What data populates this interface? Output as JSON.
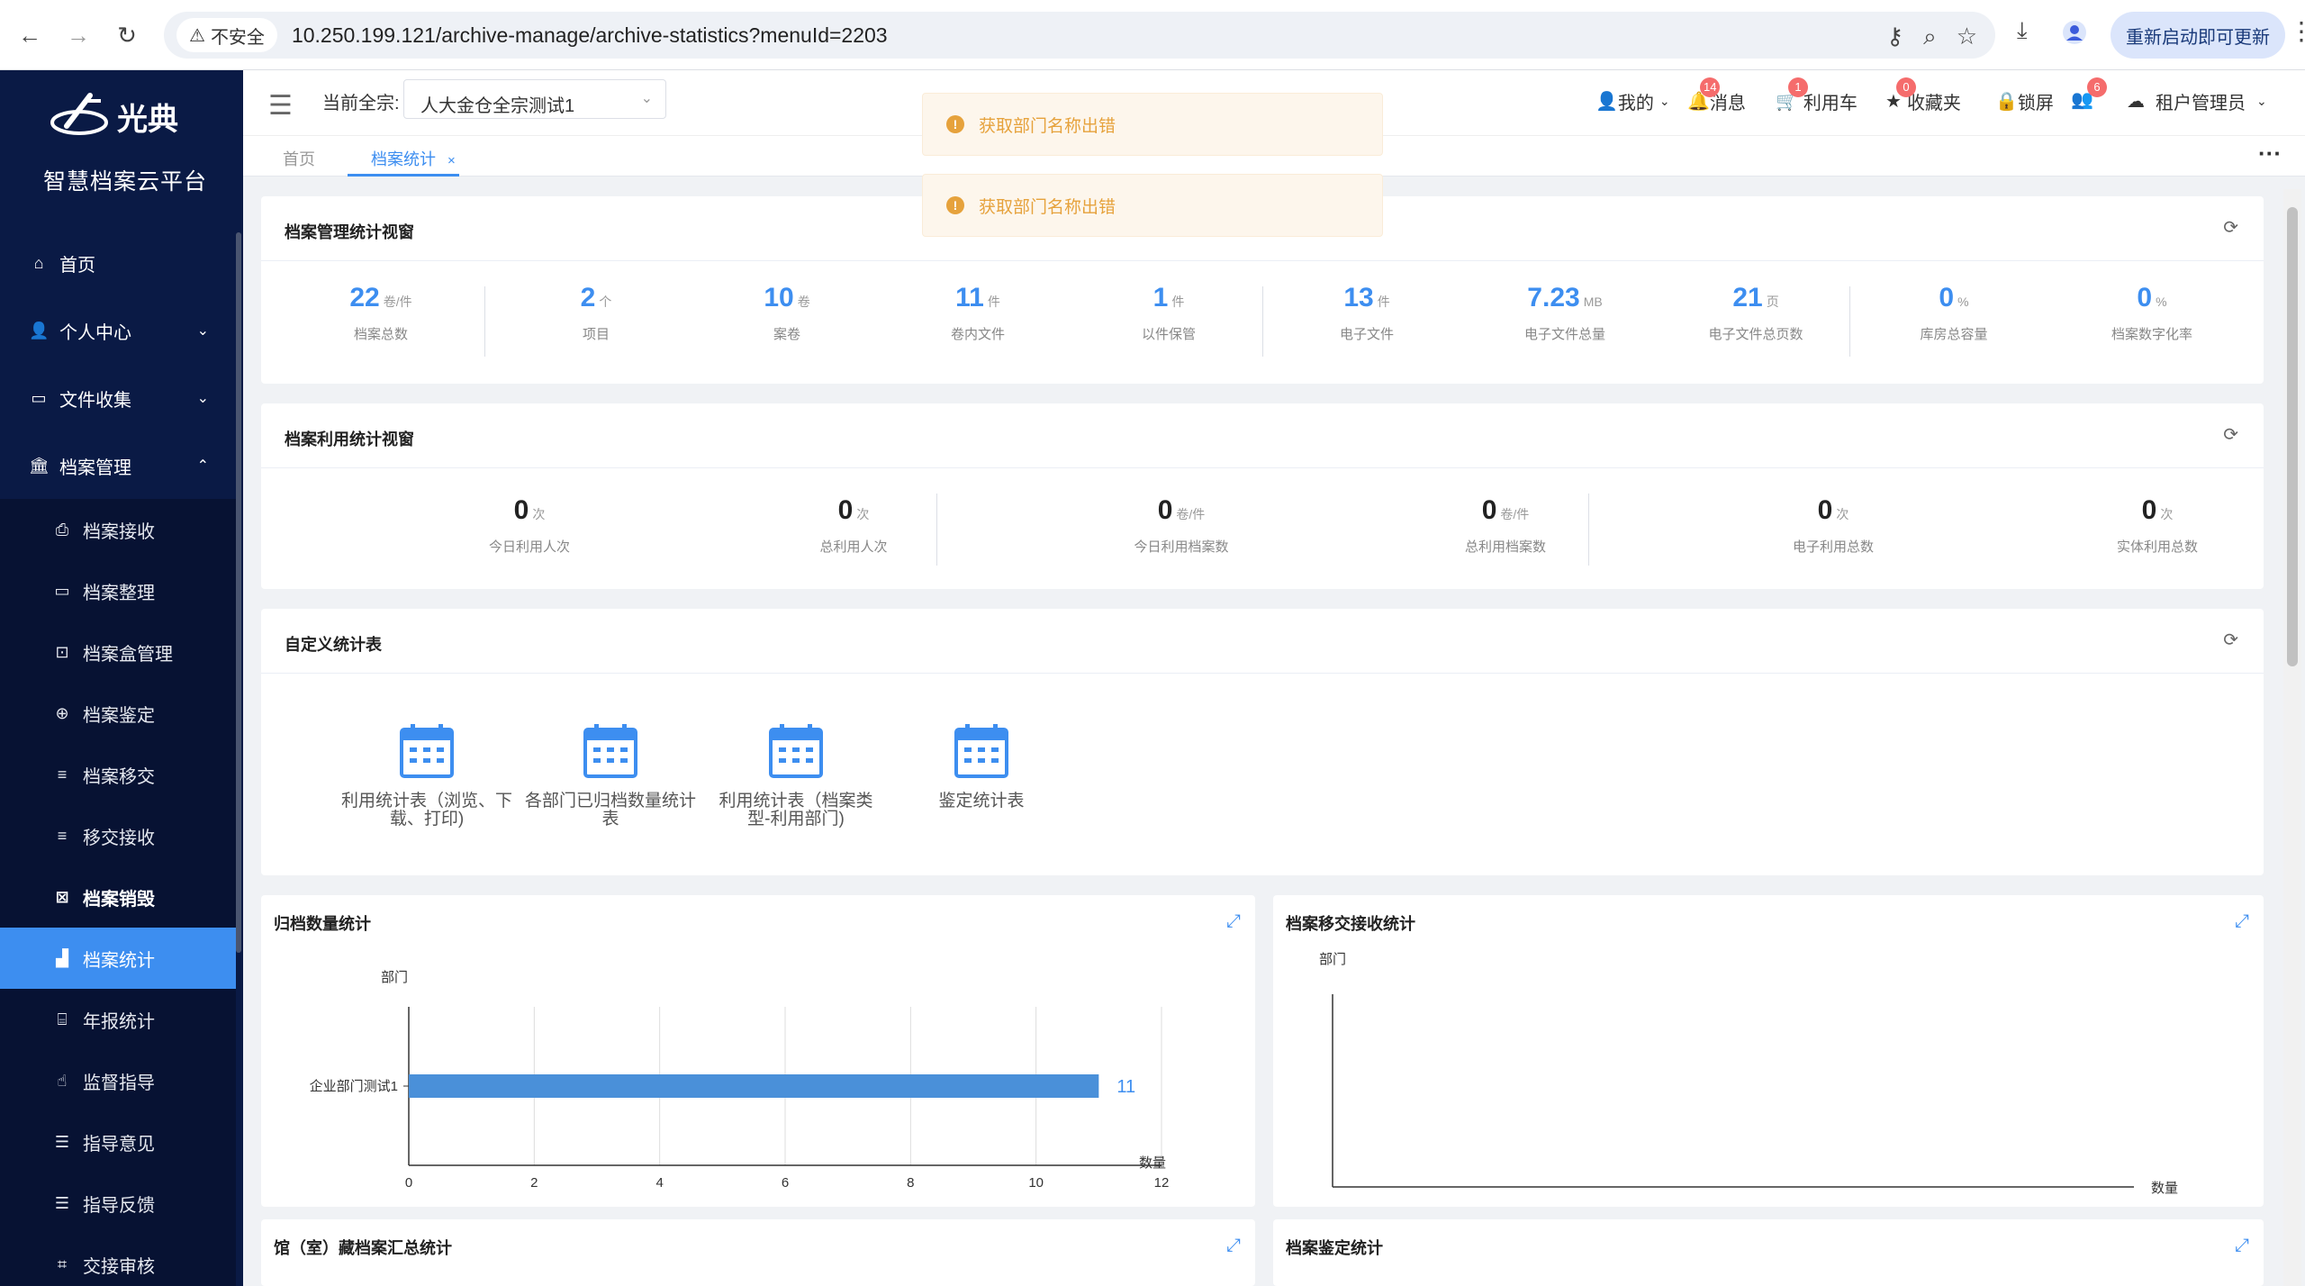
{
  "browser": {
    "insecure_label": "不安全",
    "url": "10.250.199.121/archive-manage/archive-statistics?menuId=2203",
    "restart_label": "重新启动即可更新"
  },
  "sidebar": {
    "logo_text": "光典",
    "platform_name": "智慧档案云平台",
    "items": [
      {
        "label": "首页",
        "icon": "home-icon"
      },
      {
        "label": "个人中心",
        "icon": "user-icon"
      },
      {
        "label": "文件收集",
        "icon": "briefcase-icon"
      },
      {
        "label": "档案管理",
        "icon": "bank-icon"
      }
    ],
    "subitems": [
      {
        "label": "档案接收"
      },
      {
        "label": "档案整理"
      },
      {
        "label": "档案盒管理"
      },
      {
        "label": "档案鉴定"
      },
      {
        "label": "档案移交"
      },
      {
        "label": "移交接收"
      },
      {
        "label": "档案销毁"
      },
      {
        "label": "档案统计"
      },
      {
        "label": "年报统计"
      },
      {
        "label": "监督指导"
      },
      {
        "label": "指导意见"
      },
      {
        "label": "指导反馈"
      },
      {
        "label": "交接审核"
      }
    ]
  },
  "topbar": {
    "quanzong_label": "当前全宗:",
    "quanzong_value": "人大金仓全宗测试1",
    "mine": "我的",
    "messages": "消息",
    "messages_badge": "14",
    "cart": "利用车",
    "cart_badge": "1",
    "favorites": "收藏夹",
    "favorites_badge": "0",
    "lock": "锁屏",
    "users_badge": "6",
    "tenant": "租户管理员"
  },
  "tabs": [
    {
      "label": "首页"
    },
    {
      "label": "档案统计",
      "close": "×"
    }
  ],
  "toasts": [
    "获取部门名称出错",
    "获取部门名称出错"
  ],
  "mgmt": {
    "title": "档案管理统计视窗",
    "stats": [
      {
        "num": "22",
        "unit": "卷/件",
        "label": "档案总数"
      },
      {
        "num": "2",
        "unit": "个",
        "label": "项目"
      },
      {
        "num": "10",
        "unit": "卷",
        "label": "案卷"
      },
      {
        "num": "11",
        "unit": "件",
        "label": "卷内文件"
      },
      {
        "num": "1",
        "unit": "件",
        "label": "以件保管"
      },
      {
        "num": "13",
        "unit": "件",
        "label": "电子文件"
      },
      {
        "num": "7.23",
        "unit": "MB",
        "label": "电子文件总量"
      },
      {
        "num": "21",
        "unit": "页",
        "label": "电子文件总页数"
      },
      {
        "num": "0",
        "unit": "%",
        "label": "库房总容量"
      },
      {
        "num": "0",
        "unit": "%",
        "label": "档案数字化率"
      }
    ]
  },
  "usage": {
    "title": "档案利用统计视窗",
    "stats": [
      {
        "num": "0",
        "unit": "次",
        "label": "今日利用人次"
      },
      {
        "num": "0",
        "unit": "次",
        "label": "总利用人次"
      },
      {
        "num": "0",
        "unit": "卷/件",
        "label": "今日利用档案数"
      },
      {
        "num": "0",
        "unit": "卷/件",
        "label": "总利用档案数"
      },
      {
        "num": "0",
        "unit": "次",
        "label": "电子利用总数"
      },
      {
        "num": "0",
        "unit": "次",
        "label": "实体利用总数"
      }
    ]
  },
  "custom": {
    "title": "自定义统计表",
    "reports": [
      {
        "line1": "利用统计表（浏览、下",
        "line2": "载、打印)"
      },
      {
        "line1": "各部门已归档数量统计",
        "line2": "表"
      },
      {
        "line1": "利用统计表（档案类",
        "line2": "型-利用部门)"
      },
      {
        "line1": "鉴定统计表",
        "line2": ""
      }
    ]
  },
  "charts": {
    "archived_title": "归档数量统计",
    "transfer_title": "档案移交接收统计",
    "holdings_title": "馆（室）藏档案汇总统计",
    "appraisal_title": "档案鉴定统计",
    "transfer_ylabel": "部门",
    "transfer_xlabel": "数量"
  },
  "chart_data": {
    "type": "bar",
    "orientation": "horizontal",
    "categories": [
      "企业部门测试1"
    ],
    "values": [
      11
    ],
    "ylabel": "部门",
    "xlabel": "数量",
    "xlim": [
      0,
      12
    ],
    "xticks": [
      "0",
      "2",
      "4",
      "6",
      "8",
      "10",
      "12"
    ],
    "grid": true,
    "bar_color": "#4a90d9",
    "label_color": "#3d8ef0"
  }
}
